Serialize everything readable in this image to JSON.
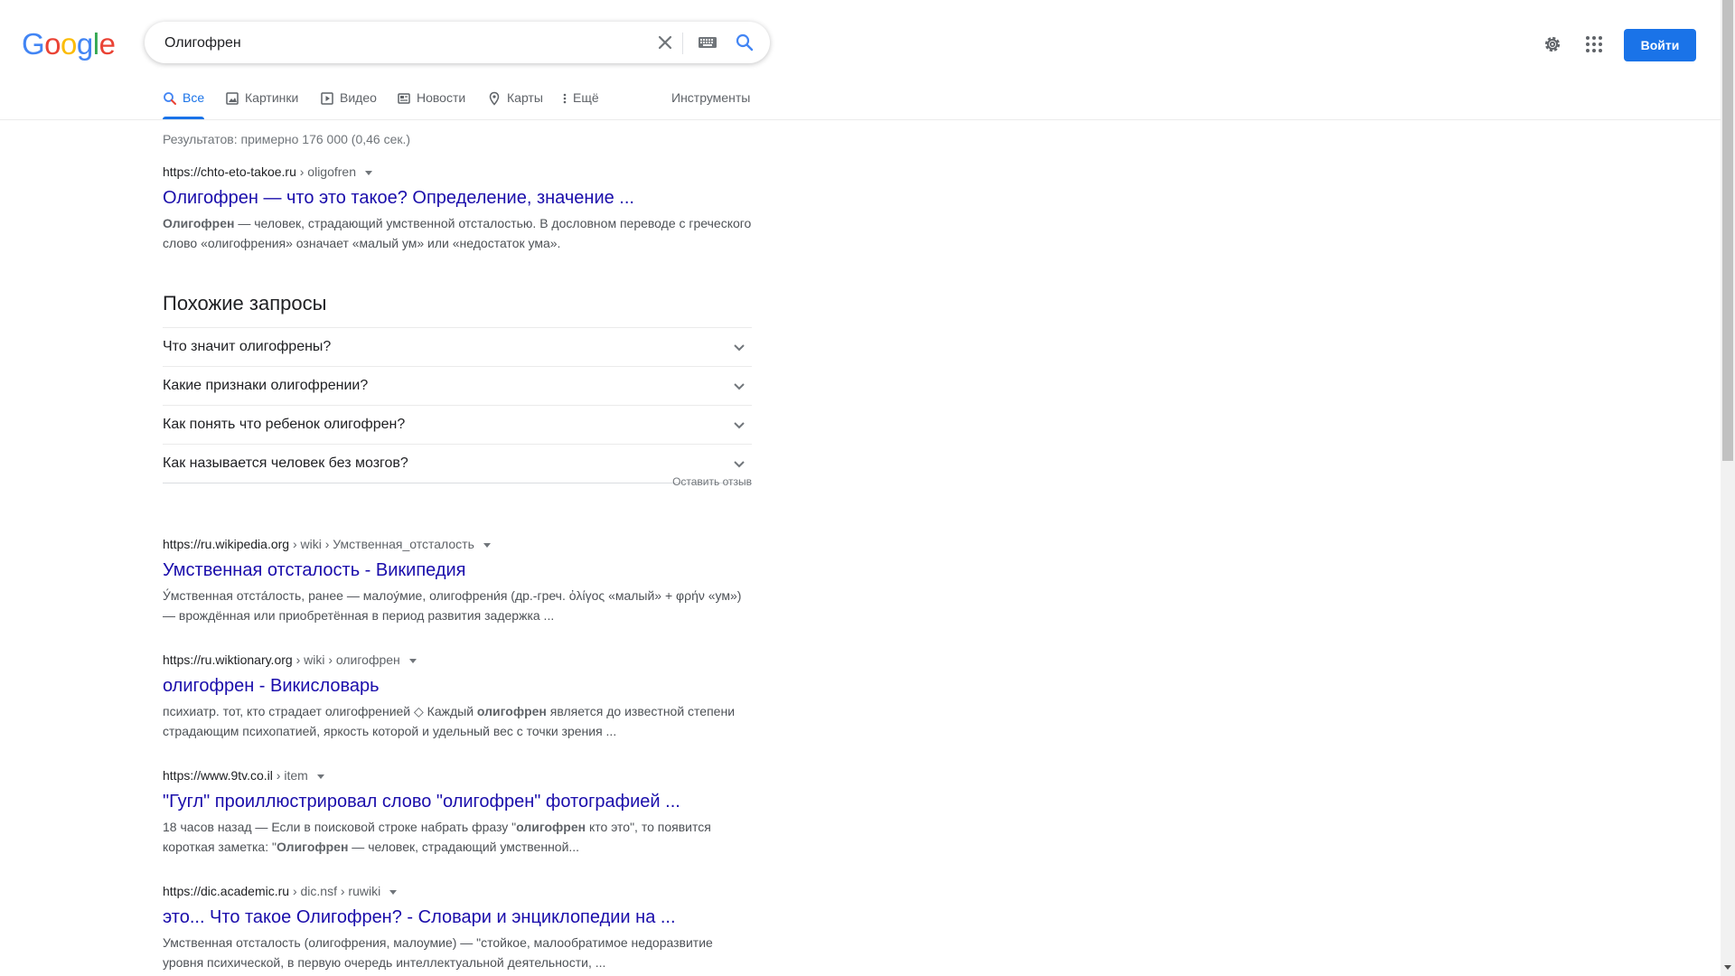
{
  "header": {
    "logo_letters": [
      "G",
      "o",
      "o",
      "g",
      "l",
      "e"
    ],
    "search_value": "Олигофрен",
    "signin_label": "Войти"
  },
  "tabs": [
    {
      "label": "Все",
      "icon": "search-icon",
      "active": true
    },
    {
      "label": "Картинки",
      "icon": "image-icon"
    },
    {
      "label": "Видео",
      "icon": "video-icon"
    },
    {
      "label": "Новости",
      "icon": "news-icon"
    },
    {
      "label": "Карты",
      "icon": "map-pin-icon"
    },
    {
      "label": "Ещё",
      "icon": "more-vert-icon"
    }
  ],
  "tools_label": "Инструменты",
  "stats": "Результатов: примерно 176 000 (0,46 сек.)",
  "results": [
    {
      "site": "https://chto-eto-takoe.ru",
      "path": " › oligofren",
      "title": "Олигофрен — что это такое? Определение, значение ...",
      "snippet_bold": "Олигофрен",
      "snippet": " — человек, страдающий умственной отсталостью. В дословном переводе с греческого слово «олигофрения» означает «малый ум» или «недостаток ума»."
    },
    {
      "site": "https://ru.wikipedia.org",
      "path": " › wiki › Умственная_отсталость",
      "title": "Умственная отсталость - Википедия",
      "snippet": "У́мственная отста́лость, ранее — малоу́мие, олигофрени́я (др.-греч. ὀλίγος «малый» + φρήν «ум») — врождённая или приобретённая в период развития задержка ..."
    },
    {
      "site": "https://ru.wiktionary.org",
      "path": " › wiki › олигофрен",
      "title": "олигофрен - Викисловарь",
      "snippet_pre": "психиатр. тот, кто страдает олигофренией ◇ Каждый ",
      "snippet_bold": "олигофрен",
      "snippet": " является до известной степени страдающим психопатией, яркость которой и удельный вес с точки зрения ..."
    },
    {
      "site": "https://www.9tv.co.il",
      "path": " › item",
      "title": "\"Гугл\" проиллюстрировал слово \"олигофрен\" фотографией ...",
      "snippet_pre": "18 часов назад — Если в поисковой строке набрать фразу \"",
      "snippet_bold": "олигофрен",
      "snippet_mid": " кто это\", то появится короткая заметка: \"",
      "snippet_bold2": "Олигофрен",
      "snippet": " — человек, страдающий умственной..."
    },
    {
      "site": "https://dic.academic.ru",
      "path": " › dic.nsf › ruwiki",
      "title": "это... Что такое Олигофрен? - Словари и энциклопедии на ...",
      "snippet": "Умственная отсталость (олигофрения, малоумие) — \"стойкое, малообратимое недоразвитие уровня психической, в первую очередь интеллектуальной деятельности, ..."
    }
  ],
  "related": {
    "heading": "Похожие запросы",
    "questions": [
      "Что значит олигофрены?",
      "Какие признаки олигофрении?",
      "Как понять что ребенок олигофрен?",
      "Как называется человек без мозгов?"
    ],
    "feedback": "Оставить отзыв"
  },
  "colors": {
    "accent": "#1a73e8",
    "link": "#1a0dab",
    "logo": [
      "#4285f4",
      "#ea4335",
      "#fbbc05",
      "#4285f4",
      "#34a853",
      "#ea4335"
    ]
  }
}
